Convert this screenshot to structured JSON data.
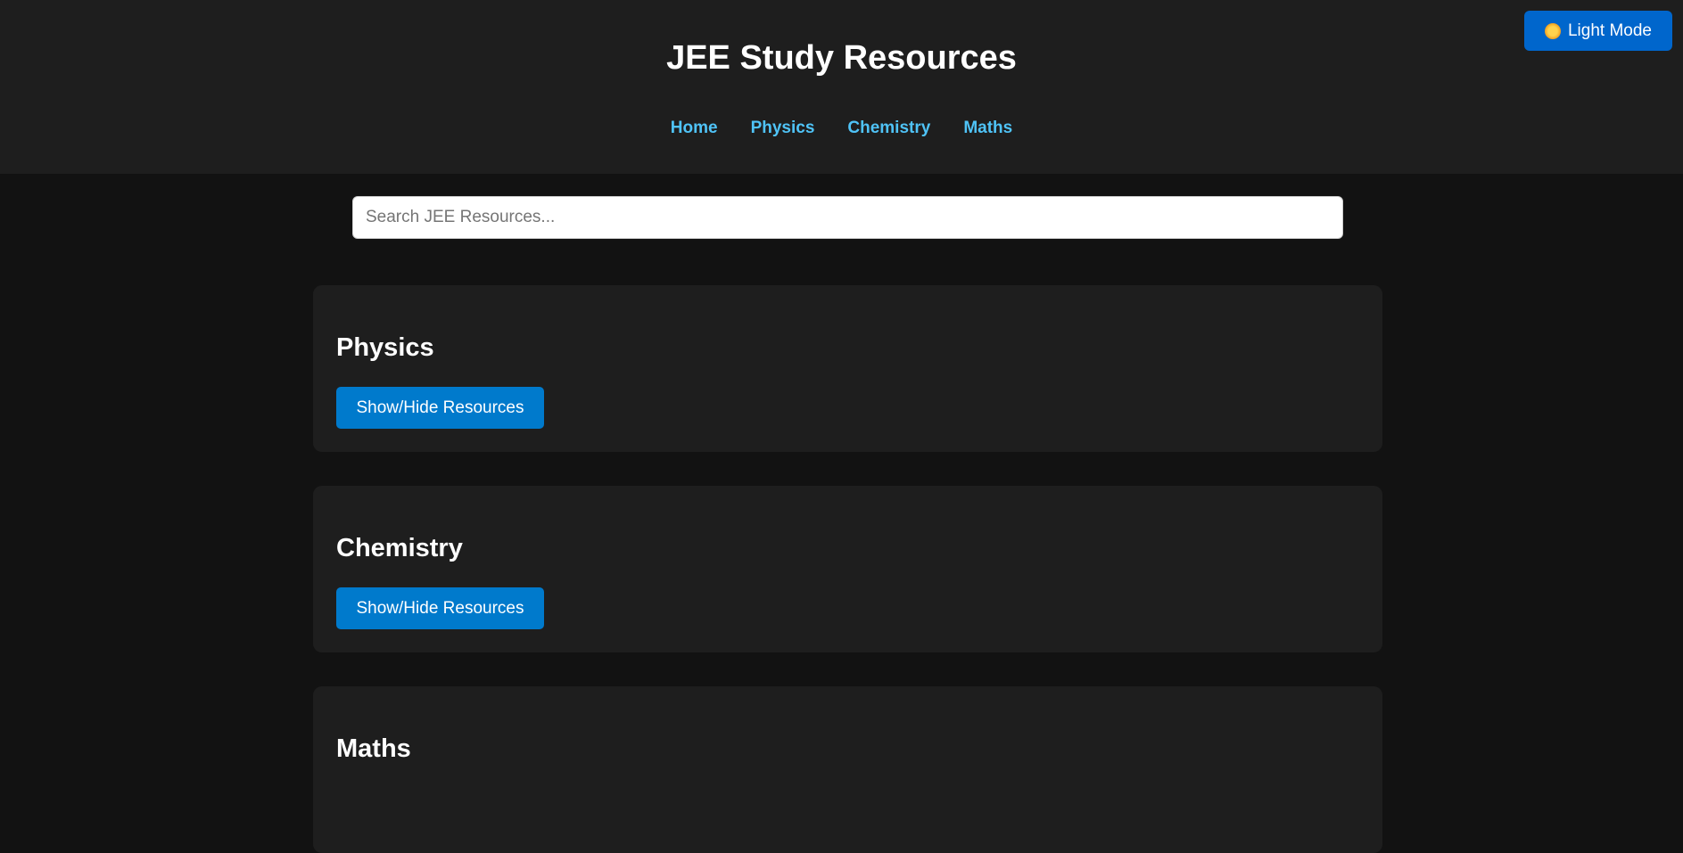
{
  "header": {
    "title": "JEE Study Resources",
    "nav": [
      "Home",
      "Physics",
      "Chemistry",
      "Maths"
    ]
  },
  "theme_toggle": {
    "label": "Light Mode",
    "icon": "sun-icon"
  },
  "search": {
    "placeholder": "Search JEE Resources...",
    "value": ""
  },
  "sections": [
    {
      "title": "Physics",
      "button": "Show/Hide Resources"
    },
    {
      "title": "Chemistry",
      "button": "Show/Hide Resources"
    },
    {
      "title": "Maths"
    }
  ]
}
